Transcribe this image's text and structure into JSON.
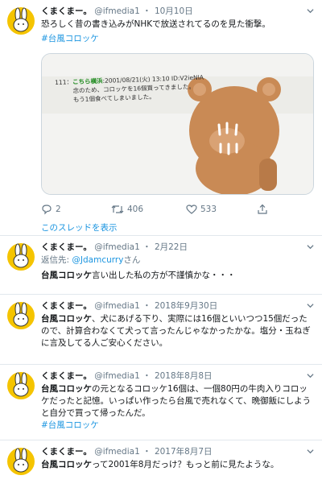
{
  "colors": {
    "accent": "#1b95e0",
    "muted": "#657786",
    "avatar_bg": "#f5c400",
    "divider": "#e1e8ed"
  },
  "tweets": [
    {
      "name": "くまくまー。",
      "handle": "@ifmedia1",
      "date": "10月10日",
      "text": "恐ろしく昔の書き込みがNHKで放送されてるのを見た衝撃。",
      "hashtag": "#台風コロッケ",
      "card": {
        "post_number": "111：",
        "post_name": "こちら横浜",
        "post_meta": ":2001/08/21(火) 13:10 ID:V2ieNIA",
        "post_line1": "念のため、コロッケを16個買ってきました。",
        "post_line2": "もう1個食べてしまいました。"
      },
      "actions": {
        "reply": "2",
        "retweet": "406",
        "like": "533"
      }
    },
    {
      "name": "くまくまー。",
      "handle": "@ifmedia1",
      "date": "2月22日",
      "reply_prefix": "返信先: ",
      "reply_to": "@Jdamcurry",
      "reply_suffix": "さん",
      "text_bold": "台風コロッケ",
      "text_rest": "言い出した私の方が不謹慎かな・・・"
    },
    {
      "name": "くまくまー。",
      "handle": "@ifmedia1",
      "date": "2018年9月30日",
      "text_bold": "台風コロッケ",
      "text_rest": "、犬にあげる下り、実際には16個といいつつ15個だったので、計算合わなくて犬って言ったんじゃなかったかな。塩分・玉ねぎに言及してる人ご安心ください。"
    },
    {
      "name": "くまくまー。",
      "handle": "@ifmedia1",
      "date": "2018年8月8日",
      "text_bold": "台風コロッケ",
      "text_rest": "の元となるコロッケ16個は、一個80円の牛肉入りコロッケだったと記憶。いっぱい作ったら台風で売れなくて、晩御飯にしようと自分で買って帰ったんだ。",
      "hashtag": "#台風コロッケ"
    },
    {
      "name": "くまくまー。",
      "handle": "@ifmedia1",
      "date": "2017年8月7日",
      "text_bold": "台風コロッケ",
      "text_rest": "って2001年8月だっけ？もっと前に見たような。"
    }
  ],
  "separator": "・",
  "thread_link": "このスレッドを表示"
}
